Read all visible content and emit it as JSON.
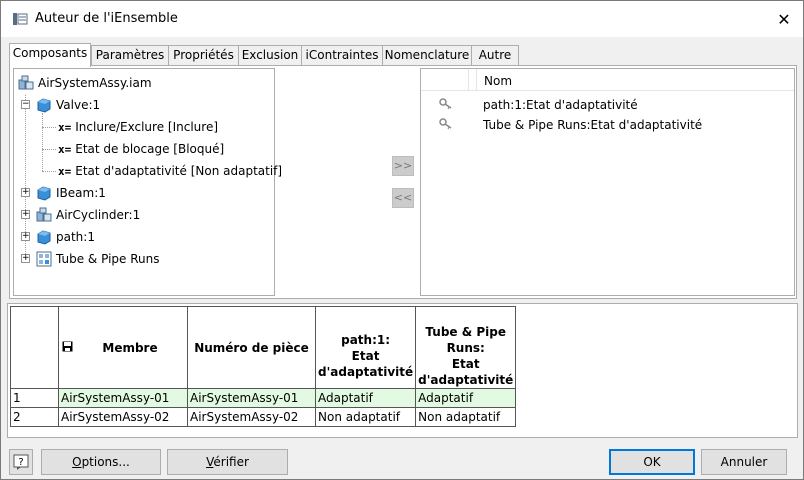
{
  "window": {
    "title": "Auteur de l'iEnsemble"
  },
  "tabs": [
    {
      "label": "Composants",
      "active": true
    },
    {
      "label": "Paramètres"
    },
    {
      "label": "Propriétés"
    },
    {
      "label": "Exclusion"
    },
    {
      "label": "iContraintes"
    },
    {
      "label": "Nomenclature"
    },
    {
      "label": "Autre"
    }
  ],
  "tree": {
    "items": [
      {
        "label": "AirSystemAssy.iam"
      },
      {
        "label": "Valve:1"
      },
      {
        "label": "Inclure/Exclure [Inclure]",
        "prefix": "x="
      },
      {
        "label": "Etat de blocage [Bloqué]",
        "prefix": "x="
      },
      {
        "label": "Etat d'adaptativité [Non adaptatif]",
        "prefix": "x="
      },
      {
        "label": "IBeam:1"
      },
      {
        "label": "AirCyclinder:1"
      },
      {
        "label": "path:1"
      },
      {
        "label": "Tube & Pipe Runs"
      }
    ]
  },
  "move_buttons": {
    "add": ">>",
    "remove": "<<"
  },
  "selected": {
    "header": "Nom",
    "items": [
      {
        "label": "path:1:Etat d'adaptativité"
      },
      {
        "label": "Tube & Pipe Runs:Etat d'adaptativité"
      }
    ]
  },
  "grid": {
    "columns": [
      "Membre",
      "Numéro de pièce",
      "path:1:\nEtat\nd'adaptativité",
      "Tube & Pipe\nRuns:\nEtat\nd'adaptativité"
    ],
    "rows": [
      {
        "num": "1",
        "cells": [
          "AirSystemAssy-01",
          "AirSystemAssy-01",
          "Adaptatif",
          "Adaptatif"
        ]
      },
      {
        "num": "2",
        "cells": [
          "AirSystemAssy-02",
          "AirSystemAssy-02",
          "Non adaptatif",
          "Non adaptatif"
        ]
      }
    ]
  },
  "buttons": {
    "help": "?",
    "options_prefix": "O",
    "options_rest": "ptions...",
    "verify_prefix": "V",
    "verify_rest": "érifier",
    "ok": "OK",
    "cancel": "Annuler"
  }
}
